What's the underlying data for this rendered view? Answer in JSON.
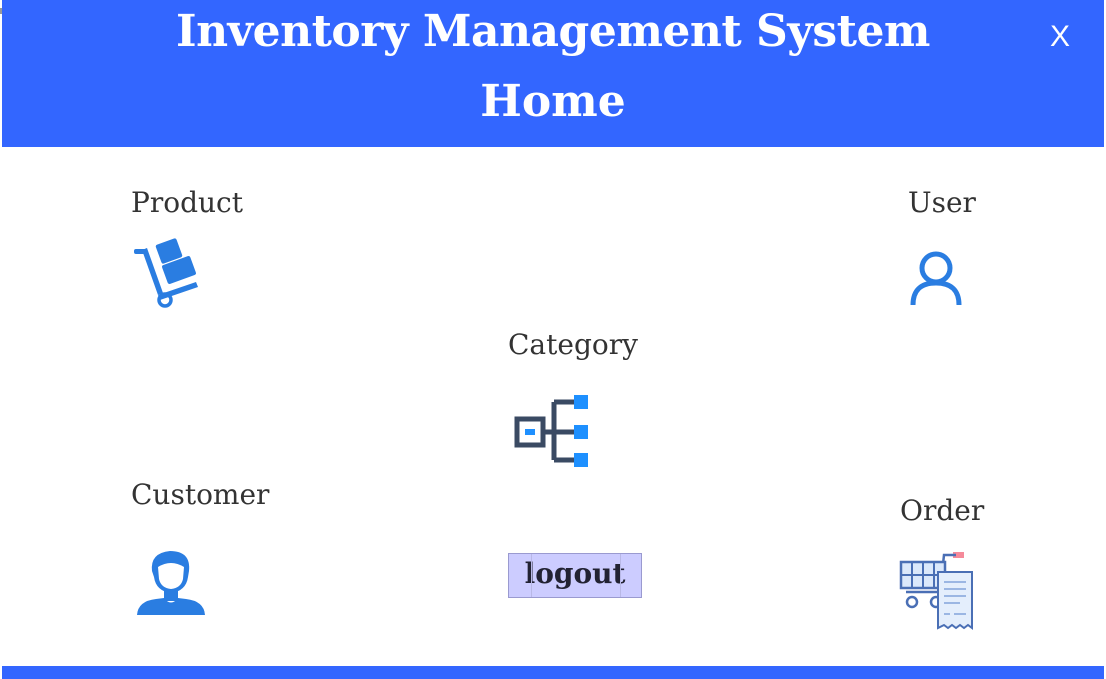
{
  "header": {
    "title": "Inventory Management System",
    "subtitle": "Home",
    "close_label": "X"
  },
  "menu": {
    "product_label": "Product",
    "user_label": "User",
    "category_label": "Category",
    "customer_label": "Customer",
    "order_label": "Order",
    "logout_label": "logout"
  },
  "icons": {
    "product": "hand-truck-icon",
    "user": "user-icon",
    "category": "hierarchy-icon",
    "customer": "customer-icon",
    "order": "shopping-cart-receipt-icon"
  },
  "colors": {
    "header_bg": "#3366ff",
    "icon_blue": "#2a7de1",
    "logout_bg": "#ccccff"
  }
}
